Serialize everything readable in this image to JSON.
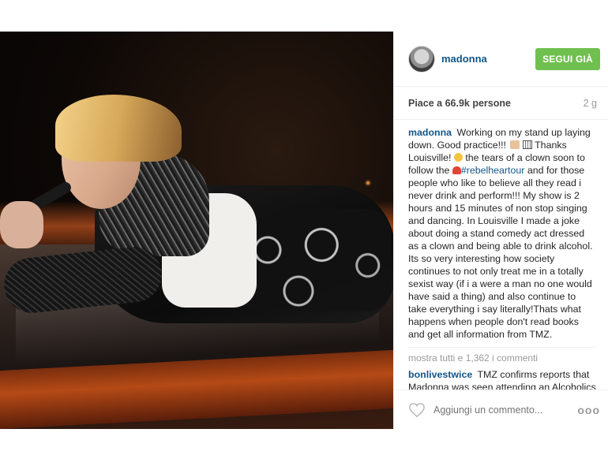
{
  "post": {
    "username": "madonna",
    "follow_label": "SEGUI GIÀ",
    "likes": "Piace a 66.9k persone",
    "time": "2 g",
    "caption": {
      "author": "madonna",
      "part1": "Working on my stand up laying down. Good practice!!!",
      "part2": "Thanks Louisville!",
      "part3": "the tears of a clown soon to follow the",
      "hashtag": "#rebelheartour",
      "part4": "and for those people who like to believe all they read i never drink and perform!!! My show is 2 hours and 15 minutes of non stop singing and dancing. In Louisville I made a joke about doing a stand comedy act dressed as a clown and being able to drink alcohol. Its so very interesting how society continues to not only treat me in a totally sexist way (if i a were a man no one would have said a thing) and also continue to take everything i say literally!Thats what happens when people don't read books and get all information from TMZ."
    },
    "more_comments": "mostra tutti e 1,362 i commenti",
    "comment": {
      "author": "bonlivestwice",
      "text": "TMZ confirms reports that Madonna was seen attending an Alcoholics Anonymous meeting in downtown"
    },
    "comment_placeholder": "Aggiungi un commento...",
    "more_label": "ooo"
  }
}
